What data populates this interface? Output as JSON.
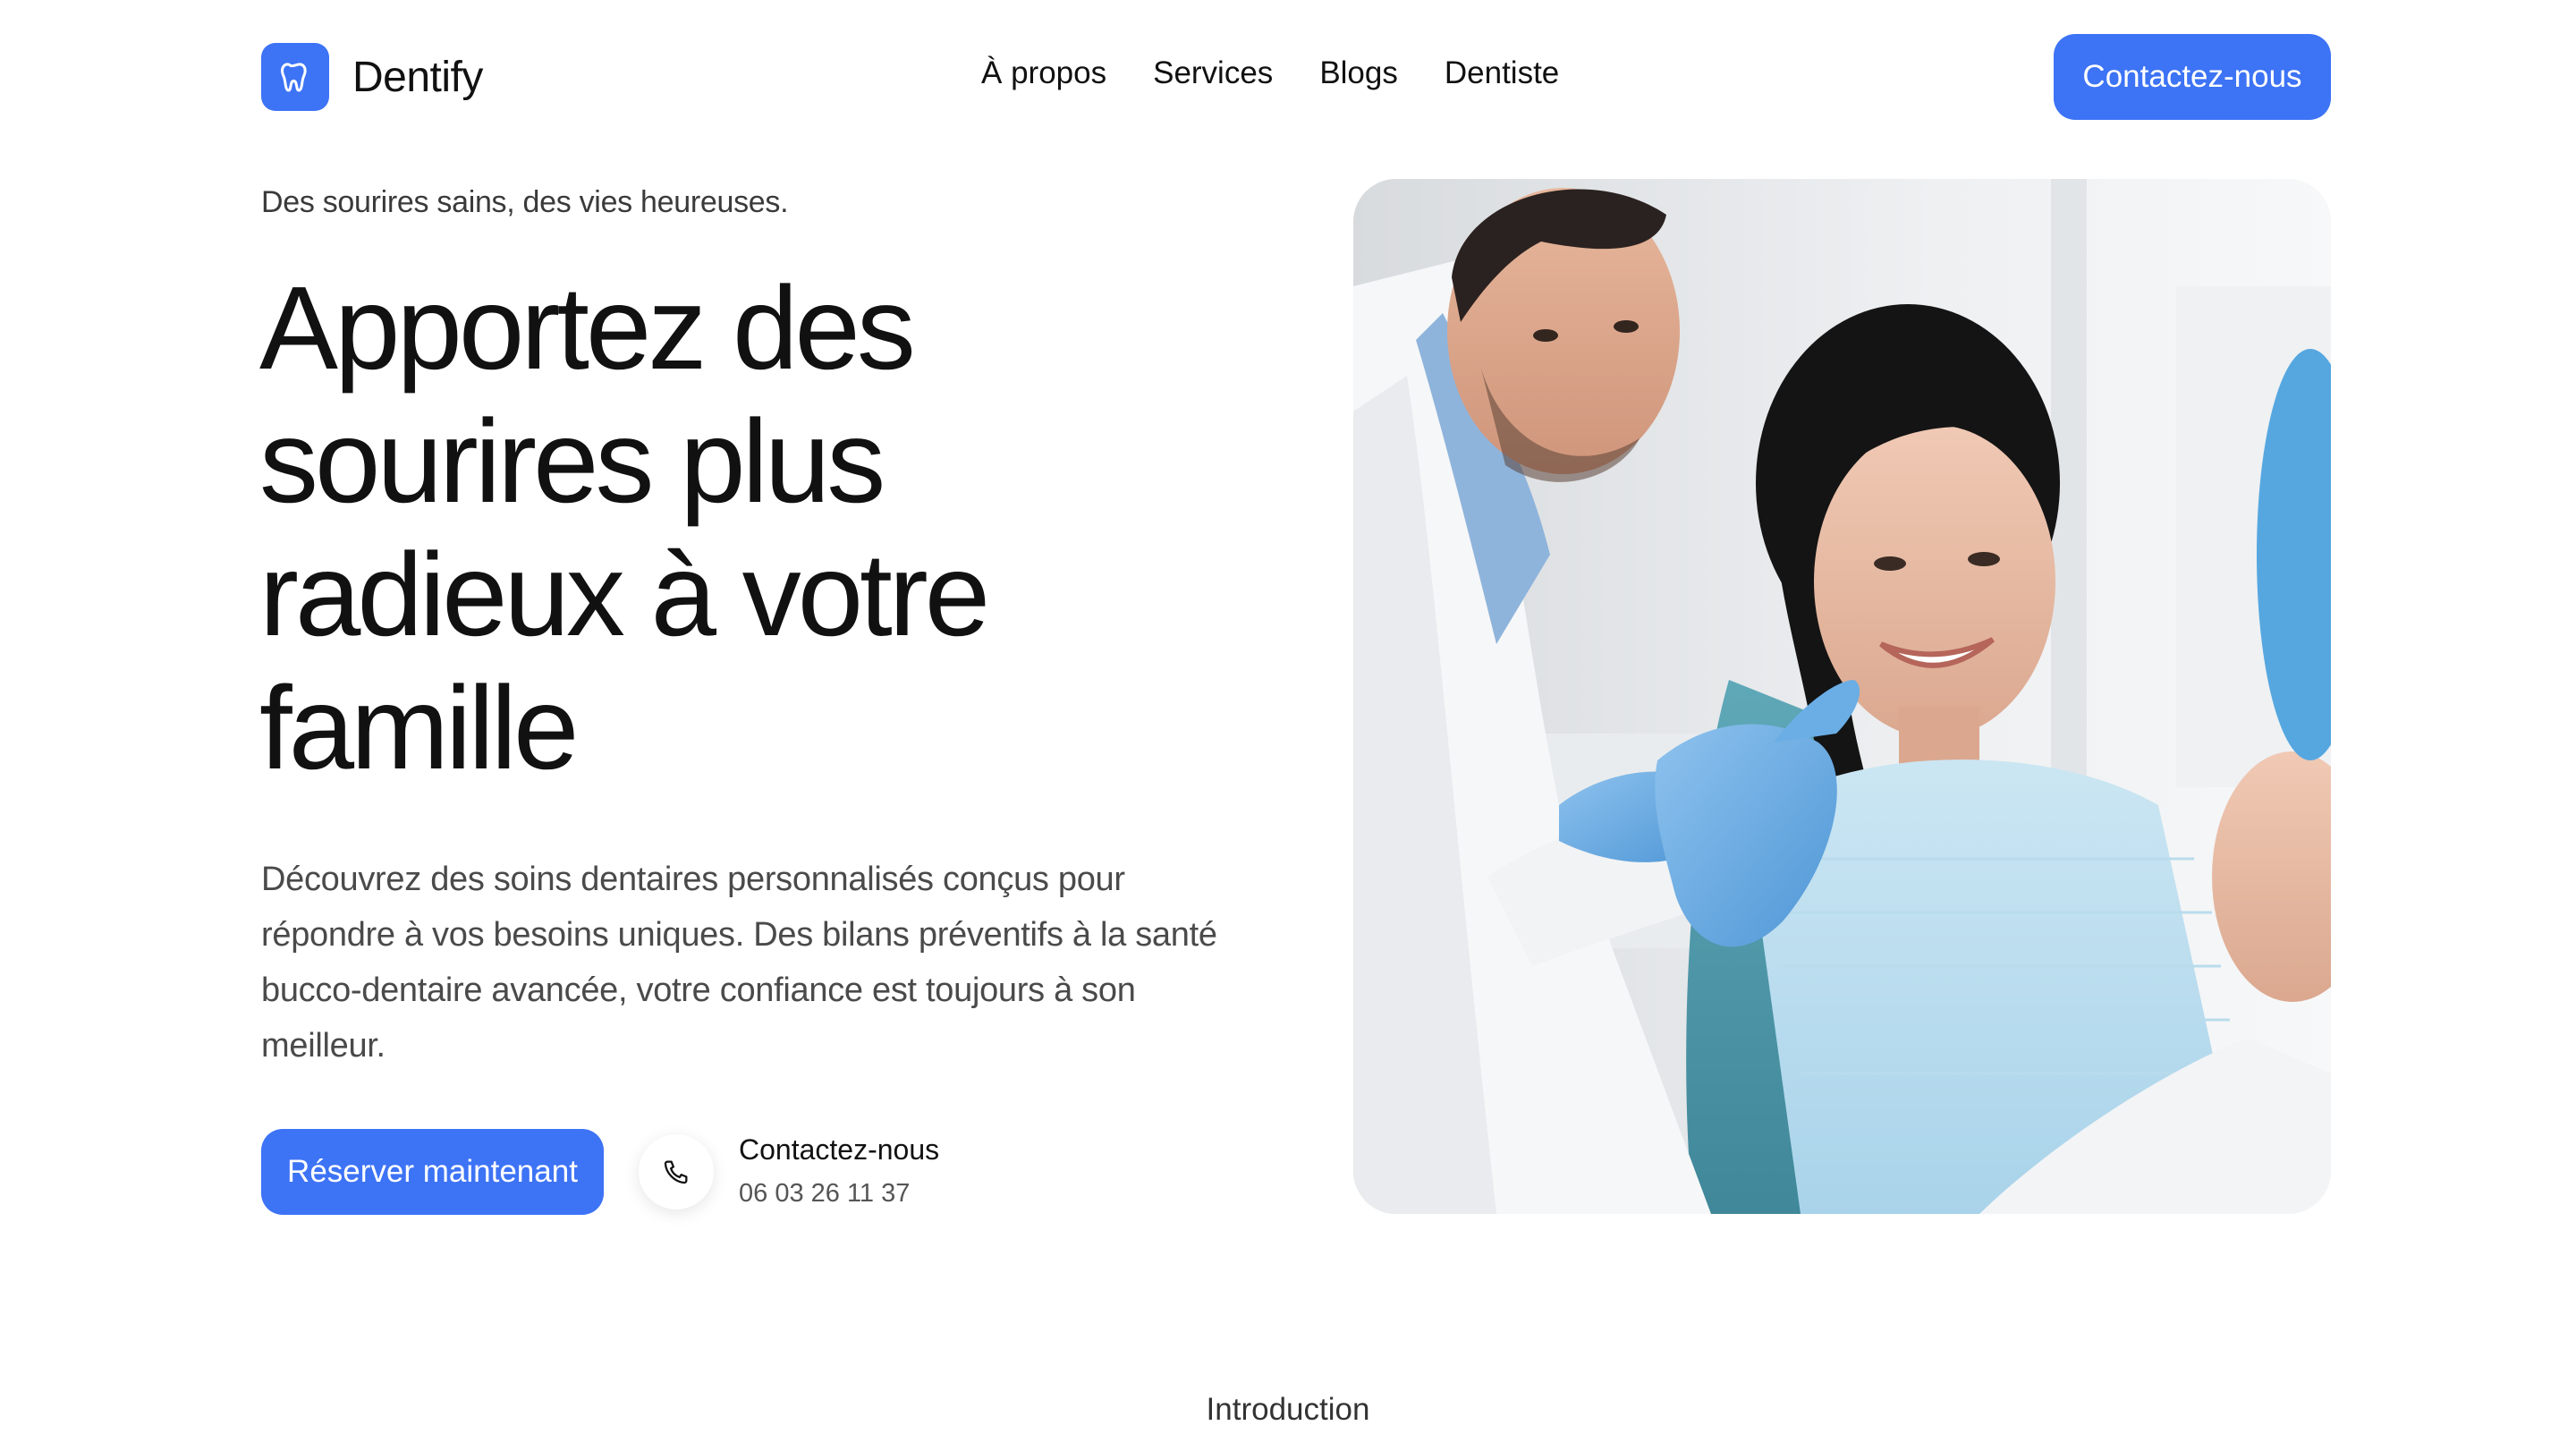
{
  "brand": {
    "name": "Dentify",
    "accent_color": "#3d73f5",
    "logo_icon": "tooth-icon"
  },
  "nav": {
    "items": [
      "À propos",
      "Services",
      "Blogs",
      "Dentiste"
    ]
  },
  "header": {
    "cta_label": "Contactez-nous"
  },
  "hero": {
    "tagline": "Des sourires sains, des vies heureuses.",
    "title": "Apportez des sourires plus radieux à votre famille",
    "description": "Découvrez des soins dentaires personnalisés conçus pour répondre à vos besoins uniques. Des bilans préventifs à la santé bucco-dentaire avancée, votre confiance est toujours à son meilleur.",
    "book_label": "Réserver maintenant",
    "contact_label": "Contactez-nous",
    "contact_phone": "06 03 26 11 37",
    "phone_icon": "phone-icon",
    "image_subject": "dentist-with-smiling-patient-photo"
  },
  "sections": {
    "next_label": "Introduction"
  }
}
